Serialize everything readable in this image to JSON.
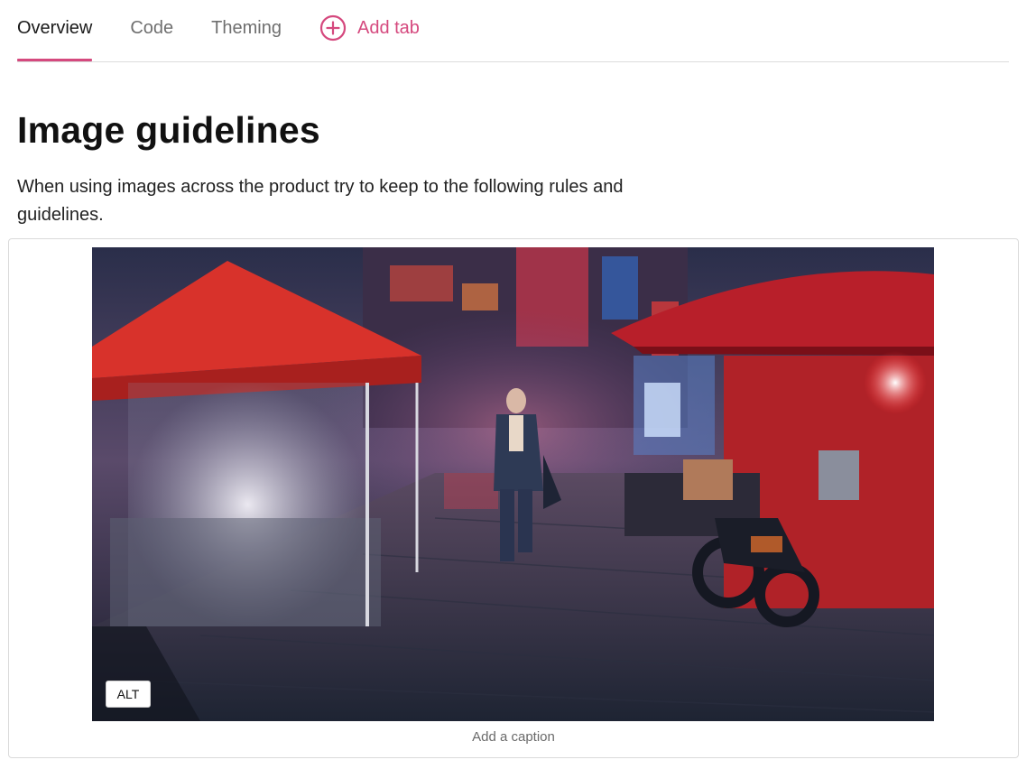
{
  "tabs": [
    {
      "label": "Overview",
      "active": true
    },
    {
      "label": "Code",
      "active": false
    },
    {
      "label": "Theming",
      "active": false
    }
  ],
  "add_tab": {
    "label": "Add tab",
    "icon": "plus-circle-icon"
  },
  "heading": "Image guidelines",
  "description": "When using images across the product try to keep to the following rules and guidelines.",
  "figure": {
    "alt_label": "ALT",
    "caption_placeholder": "Add a caption"
  },
  "colors": {
    "accent": "#d5497e"
  }
}
